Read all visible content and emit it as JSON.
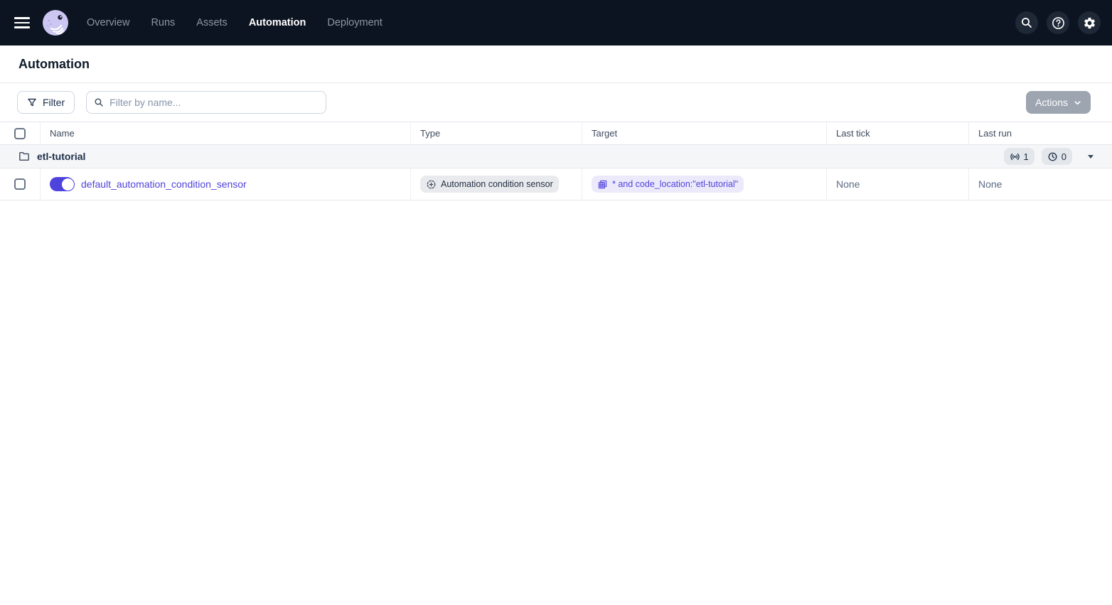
{
  "nav": {
    "items": [
      {
        "label": "Overview"
      },
      {
        "label": "Runs"
      },
      {
        "label": "Assets"
      },
      {
        "label": "Automation"
      },
      {
        "label": "Deployment"
      }
    ],
    "active_item": "Automation",
    "icons": {
      "menu": "hamburger-icon",
      "logo": "dagster-logo",
      "search": "search-icon",
      "help": "help-icon",
      "settings": "gear-icon"
    }
  },
  "page": {
    "title": "Automation"
  },
  "toolbar": {
    "filter_label": "Filter",
    "search_placeholder": "Filter by name...",
    "search_value": "",
    "actions_label": "Actions"
  },
  "table": {
    "headers": {
      "name": "Name",
      "type": "Type",
      "target": "Target",
      "last_tick": "Last tick",
      "last_run": "Last run"
    },
    "group": {
      "name": "etl-tutorial",
      "sensor_count": "1",
      "schedule_count": "0"
    },
    "row": {
      "name": "default_automation_condition_sensor",
      "type_label": "Automation condition sensor",
      "target_label": "* and code_location:\"etl-tutorial\"",
      "last_tick": "None",
      "last_run": "None",
      "toggle_state": "on"
    }
  },
  "colors": {
    "accent": "#4f43dd",
    "nav_bg": "#0d1421",
    "logo_bg": "#cbc7f2",
    "tag_purple_bg": "#ece9fb",
    "tag_gray_bg": "#e9eaed",
    "actions_disabled_bg": "#9da5b0",
    "group_row_bg": "#f5f6f8"
  }
}
